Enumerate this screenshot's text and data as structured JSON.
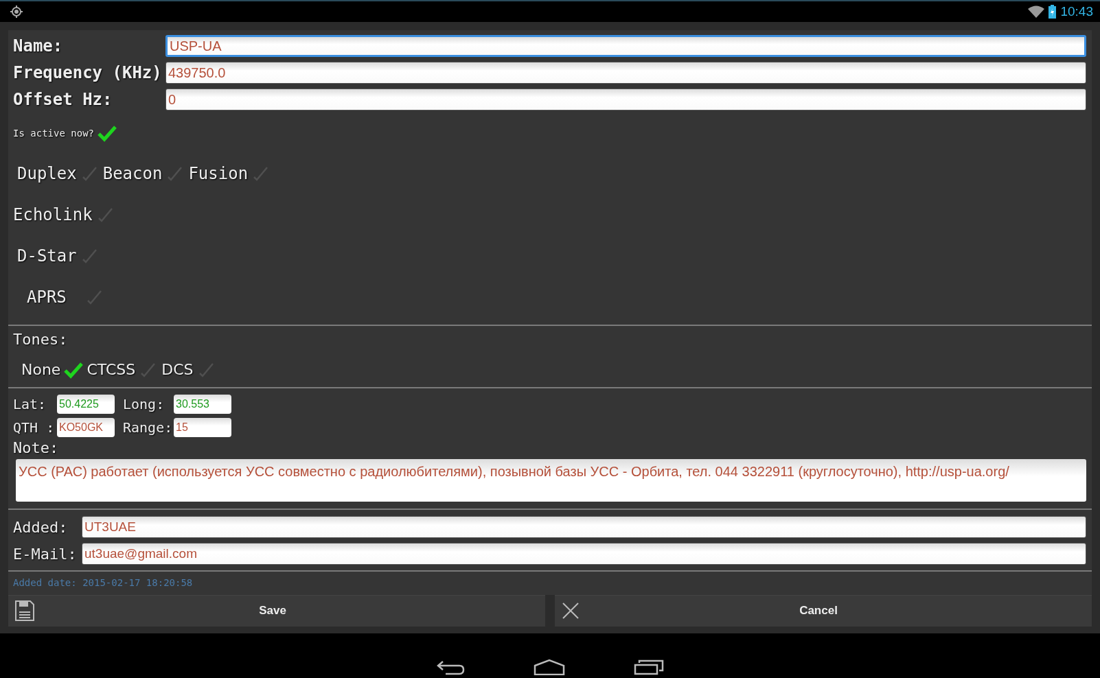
{
  "status_bar": {
    "time": "10:43"
  },
  "fields": [
    {
      "label": "Name:",
      "value": "USP-UA",
      "focused": true
    },
    {
      "label": "Frequency (KHz)",
      "value": "439750.0",
      "focused": false
    },
    {
      "label": "Offset Hz:",
      "value": "0",
      "focused": false
    }
  ],
  "active": {
    "label": "Is active now?",
    "checked": true
  },
  "modes": [
    [
      {
        "label": "Duplex",
        "checked": false
      },
      {
        "label": "Beacon",
        "checked": false
      },
      {
        "label": "Fusion",
        "checked": false
      }
    ],
    [
      {
        "label": "Echolink",
        "checked": false
      }
    ],
    [
      {
        "label": "D-Star",
        "checked": false
      }
    ],
    [
      {
        "label": "APRS",
        "checked": false
      }
    ]
  ],
  "tones": {
    "label": "Tones:",
    "options": [
      {
        "label": "None",
        "selected": true
      },
      {
        "label": "CTCSS",
        "selected": false
      },
      {
        "label": "DCS",
        "selected": false
      }
    ]
  },
  "location": [
    [
      {
        "label": "Lat:",
        "value": "50.4225",
        "kind": "coord"
      },
      {
        "label": "Long:",
        "value": "30.553",
        "kind": "coord"
      }
    ],
    [
      {
        "label": "QTH :",
        "value": "KO50GK",
        "kind": "text"
      },
      {
        "label": "Range:",
        "value": "15",
        "kind": "text"
      }
    ]
  ],
  "note": {
    "label": "Note:",
    "value": "УСС (РАС) работает (используется УСС совместно с радиолюбителями), позывной базы УСС - Орбита, тел. 044 3322911 (круглосуточно), http://usp-ua.org/"
  },
  "contact": [
    {
      "label": "Added:",
      "value": "UT3UAE"
    },
    {
      "label": "E-Mail:",
      "value": "ut3uae@gmail.com"
    }
  ],
  "added_date": "Added date: 2015-02-17 18:20:58",
  "buttons": [
    {
      "label": "Save",
      "kind": "save"
    },
    {
      "label": "Cancel",
      "kind": "cancel"
    }
  ]
}
